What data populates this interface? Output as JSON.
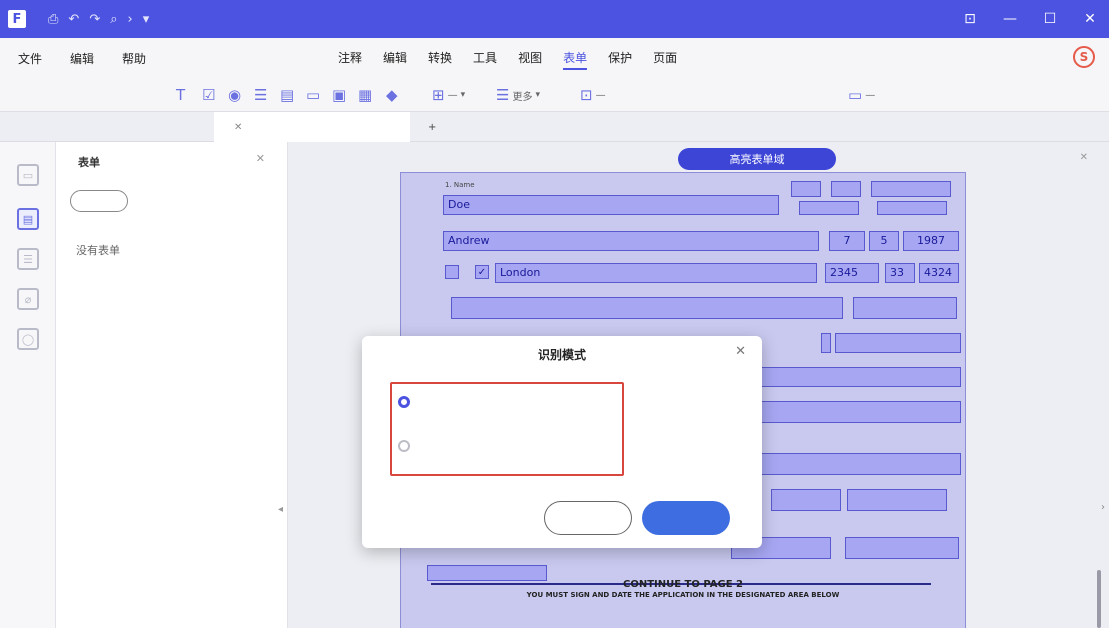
{
  "titlebar": {
    "app_logo": "F",
    "title": "",
    "quick_actions": [
      "⎙",
      "↶",
      "↷",
      "⌕",
      "›",
      "▾"
    ],
    "window_controls": [
      "⊡",
      "—",
      "☐",
      "✕"
    ]
  },
  "menu": {
    "left": [
      "文件",
      "编辑",
      "帮助"
    ],
    "center": [
      "注释",
      "编辑",
      "转换",
      "工具",
      "视图",
      "表单",
      "保护",
      "页面"
    ],
    "active": "表单",
    "avatar": "S"
  },
  "ribbon": {
    "tools": [
      {
        "icon": "T",
        "name": "text-field-icon"
      },
      {
        "icon": "☑",
        "name": "checkbox-icon"
      },
      {
        "icon": "◉",
        "name": "radio-button-icon"
      },
      {
        "icon": "☰",
        "name": "list-box-icon"
      },
      {
        "icon": "▤",
        "name": "combo-box-icon"
      },
      {
        "icon": "▭",
        "name": "button-icon"
      },
      {
        "icon": "▣",
        "name": "image-field-icon"
      },
      {
        "icon": "▦",
        "name": "date-field-icon"
      },
      {
        "icon": "◆",
        "name": "signature-field-icon"
      }
    ],
    "group_tools": [
      {
        "icon": "⊞",
        "label": "—",
        "name": "align-tool"
      },
      {
        "icon": "☰",
        "label": "更多",
        "name": "more-tool"
      },
      {
        "icon": "⊡",
        "label": "—",
        "name": "recognize-tool"
      },
      {
        "icon": "▭",
        "label": "—",
        "name": "preview-tool"
      }
    ]
  },
  "tabs": [
    {
      "label": "",
      "active": false
    },
    {
      "label": "",
      "active": true
    }
  ],
  "panel": {
    "title": "表单",
    "button": "",
    "empty_text": "没有表单"
  },
  "form_banner": {
    "text": "",
    "button": "高亮表单域"
  },
  "page_fields": {
    "last_name": "Doe",
    "first_name": "Andrew",
    "dob_month": "7",
    "dob_day": "5",
    "dob_year": "1987",
    "birthplace": "London",
    "ssn_1": "2345",
    "ssn_2": "33",
    "ssn_3": "4324",
    "sex_check": "✓",
    "continue_text": "CONTINUE TO PAGE 2",
    "sign_text": "YOU MUST SIGN AND DATE THE APPLICATION IN THE DESIGNATED AREA BELOW"
  },
  "modal": {
    "title": "识别模式",
    "option1_title": "",
    "option1_sub": "",
    "option2_title": "",
    "option2_sub": "",
    "cancel": "",
    "ok": ""
  }
}
